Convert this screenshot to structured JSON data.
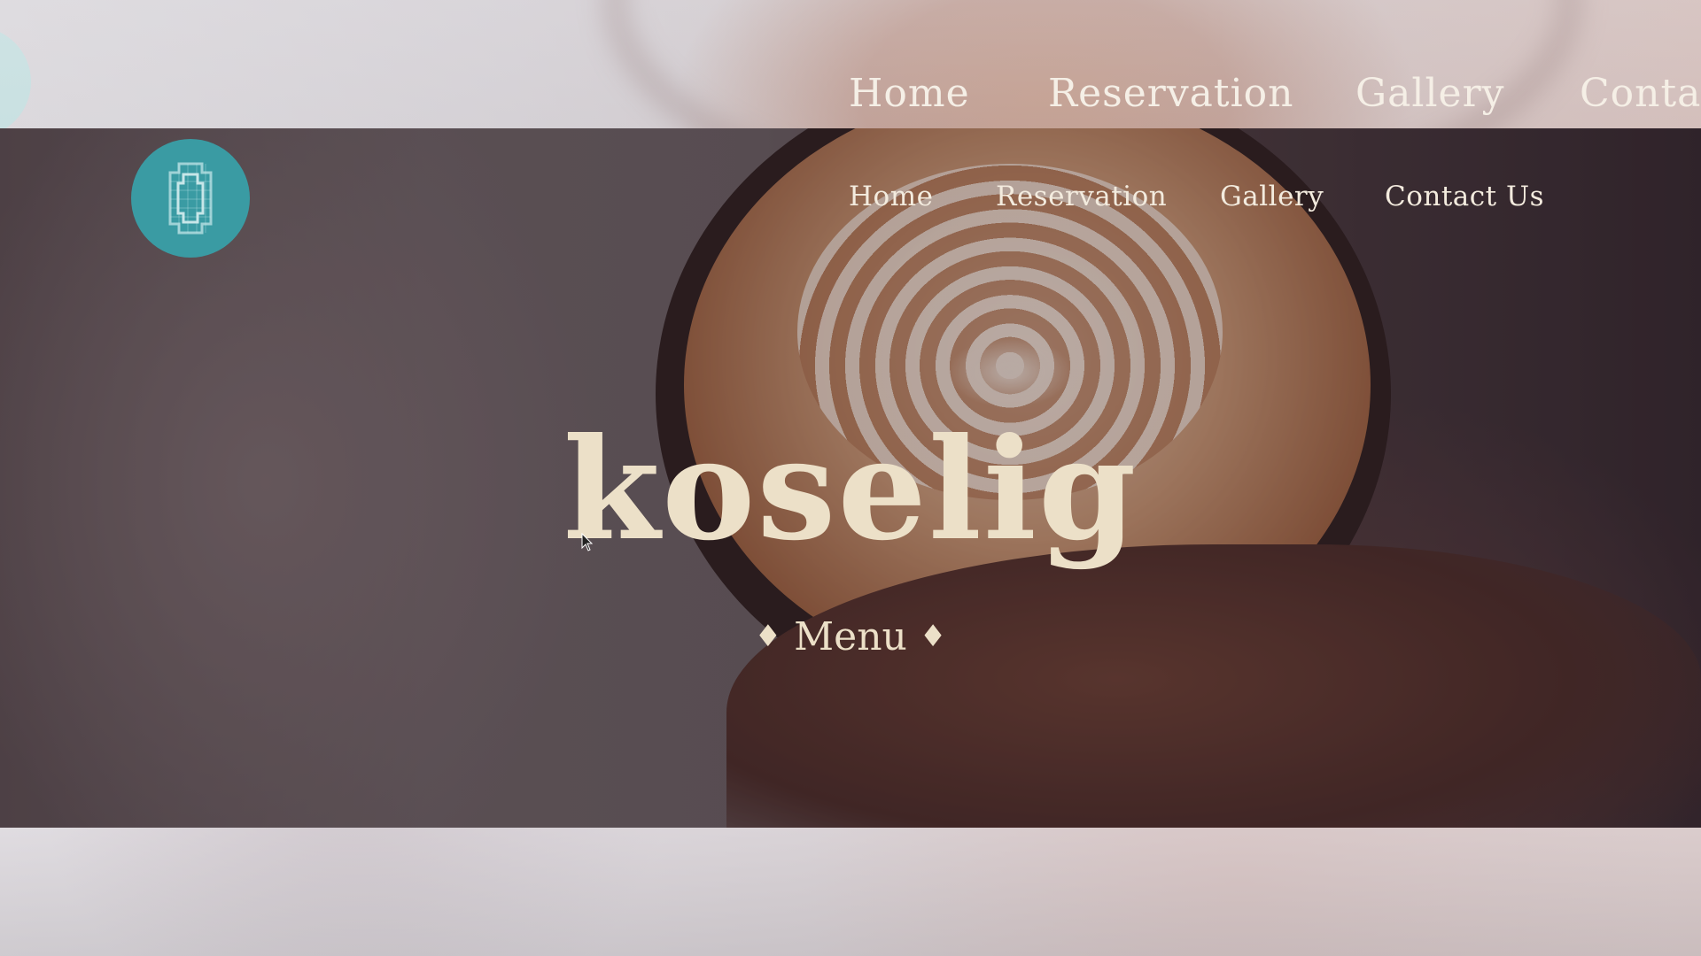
{
  "ghost_nav": {
    "items": [
      "Home",
      "Reservation",
      "Gallery",
      "Contac"
    ]
  },
  "header": {
    "logo_icon": "pixel-octagon-logo-icon",
    "nav": [
      {
        "label": "Home"
      },
      {
        "label": "Reservation"
      },
      {
        "label": "Gallery"
      },
      {
        "label": "Contact Us"
      }
    ]
  },
  "hero": {
    "brand": "koselig",
    "menu_label": "Menu",
    "diamond": "♦"
  },
  "colors": {
    "accent_teal": "#3a9ba3",
    "text_cream": "#ece0c8"
  }
}
